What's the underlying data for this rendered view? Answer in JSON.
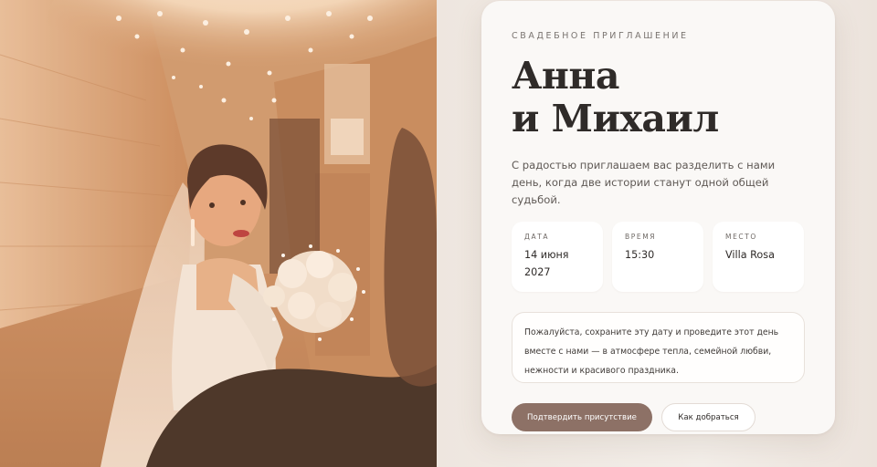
{
  "photo": {
    "alt": "Невеста с букетом в коридоре с гирляндами"
  },
  "invitation": {
    "eyebrow": "СВАДЕБНОЕ ПРИГЛАШЕНИЕ",
    "name_line1": "Анна",
    "name_line2": "и Михаил",
    "intro": "С радостью приглашаем вас разделить с нами день, когда две истории станут одной общей судьбой."
  },
  "details": [
    {
      "label": "ДАТА",
      "value": "14 июня 2027"
    },
    {
      "label": "ВРЕМЯ",
      "value": "15:30"
    },
    {
      "label": "МЕСТО",
      "value": "Villa Rosa"
    }
  ],
  "note": "Пожалуйста, сохраните эту дату и проведите этот день вместе с нами — в атмосфере тепла, семейной любви, нежности и красивого праздника.",
  "actions": {
    "primary": "Подтвердить присутствие",
    "secondary": "Как добраться"
  },
  "colors": {
    "accent": "#8d7166",
    "card": "#faf8f6",
    "text": "#2f2b29"
  }
}
